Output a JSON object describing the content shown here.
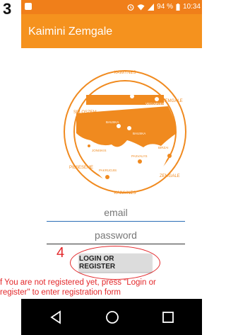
{
  "step_number": "3",
  "status_bar": {
    "signal_text": "94 %",
    "time": "10:34"
  },
  "app_bar": {
    "title": "Kaimini Zemgale"
  },
  "map_logo": {
    "top_label": "KAIMYNES",
    "left_label": "SELOSZEM",
    "right_label": "ZEMGALE",
    "bottom_label": "KAIMYNES",
    "bottom_left_label": "PILSESEME",
    "bottom_right_label": "ZEMGALE",
    "cities": [
      "JELAVA",
      "VECUMNIEKI",
      "BAUSKA",
      "BAUSKA",
      "JONISKIS",
      "PASVALYS",
      "BIRZAI",
      "PAKRUOJIS"
    ]
  },
  "form": {
    "email_placeholder": "email",
    "password_placeholder": "password",
    "login_button": "LOGIN OR REGISTER"
  },
  "annotation": {
    "step4_number": "4",
    "help_line1": "f You are not registered yet, press \"Login or",
    "help_line2": "register\" to enter registration form",
    "color": "#e3272a"
  },
  "colors": {
    "status_bar": "#f07f1a",
    "app_bar": "#f5921e",
    "logo_orange": "#f08a1f"
  }
}
